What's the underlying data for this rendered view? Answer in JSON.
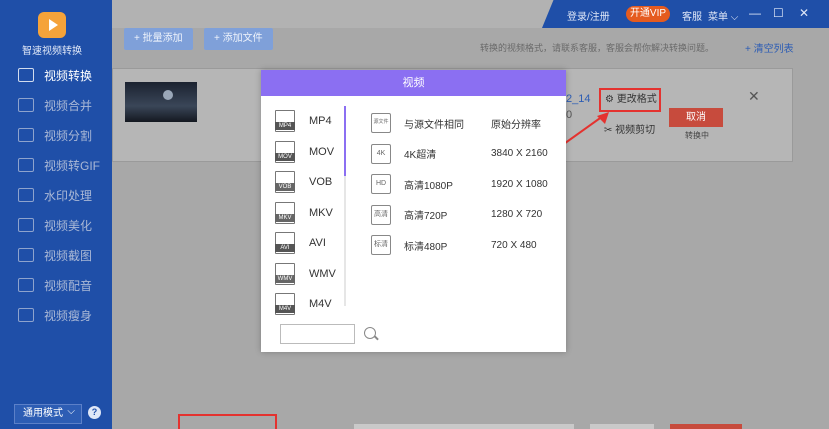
{
  "app": {
    "name": "智速视频转换"
  },
  "sidebar": {
    "items": [
      {
        "label": "视频转换",
        "active": true
      },
      {
        "label": "视频合并"
      },
      {
        "label": "视频分割"
      },
      {
        "label": "视频转GIF"
      },
      {
        "label": "水印处理"
      },
      {
        "label": "视频美化"
      },
      {
        "label": "视频截图"
      },
      {
        "label": "视频配音"
      },
      {
        "label": "视频瘦身"
      }
    ],
    "mode": "通用模式",
    "help": "?"
  },
  "header": {
    "login": "登录/注册",
    "vip": "开通VIP",
    "service": "客服",
    "menu": "菜单 ⌵",
    "minimize": "—",
    "maximize": "☐",
    "close": "✕"
  },
  "toolbar": {
    "batch_add": "+ 批量添加",
    "add_file": "+ 添加文件",
    "notice": "转换的视频格式，请联系客服，客服会帮你解决转换问题。",
    "clear_list": "+ 清空列表"
  },
  "file": {
    "name_part": "2_14",
    "info_part": "0",
    "change_format": "更改格式",
    "cut": "视频剪切",
    "cancel": "取消",
    "status": "转换中",
    "close": "✕"
  },
  "modal": {
    "title": "视频",
    "formats": [
      {
        "label": "MP4",
        "icon": "MP4"
      },
      {
        "label": "MOV",
        "icon": "MOV"
      },
      {
        "label": "VOB",
        "icon": "VOB"
      },
      {
        "label": "MKV",
        "icon": "MKV"
      },
      {
        "label": "AVI",
        "icon": "AVI"
      },
      {
        "label": "WMV",
        "icon": "WMV"
      },
      {
        "label": "M4V",
        "icon": "M4V"
      }
    ],
    "resolutions": [
      {
        "icon": "源文件",
        "name": "与源文件相同",
        "value": "原始分辨率"
      },
      {
        "icon": "4K",
        "name": "4K超清",
        "value": "3840 X 2160"
      },
      {
        "icon": "HD",
        "name": "高清1080P",
        "value": "1920 X 1080"
      },
      {
        "icon": "高清",
        "name": "高清720P",
        "value": "1280 X 720"
      },
      {
        "icon": "标清",
        "name": "标清480P",
        "value": "720 X 480"
      }
    ],
    "search_placeholder": ""
  },
  "colors": {
    "sidebar": "#1f4fa8",
    "modal_header": "#8b6ff2",
    "highlight": "#e4322f",
    "vip": "#e55b1f"
  }
}
